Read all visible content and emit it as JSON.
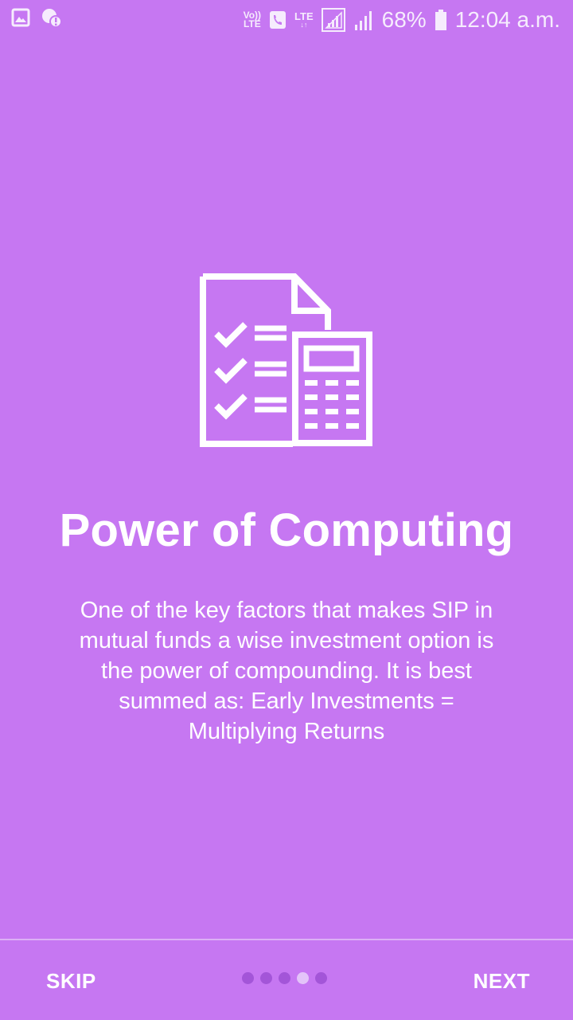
{
  "status_bar": {
    "volte_label": "Vo))\nLTE",
    "lte_label": "LTE",
    "battery": "68%",
    "time": "12:04 a.m."
  },
  "onboarding": {
    "icon": "checklist-calculator-icon",
    "title": "Power of Computing",
    "description": "One of the key factors that makes SIP in mutual funds a wise investment option is the power of compounding. It is best summed as: Early Investments = Multiplying Returns",
    "page_count": 5,
    "active_page": 4
  },
  "nav": {
    "skip_label": "SKIP",
    "next_label": "NEXT"
  },
  "colors": {
    "background": "#c677f2",
    "dot_inactive": "#a355d8",
    "dot_active": "#e3c3f9"
  }
}
